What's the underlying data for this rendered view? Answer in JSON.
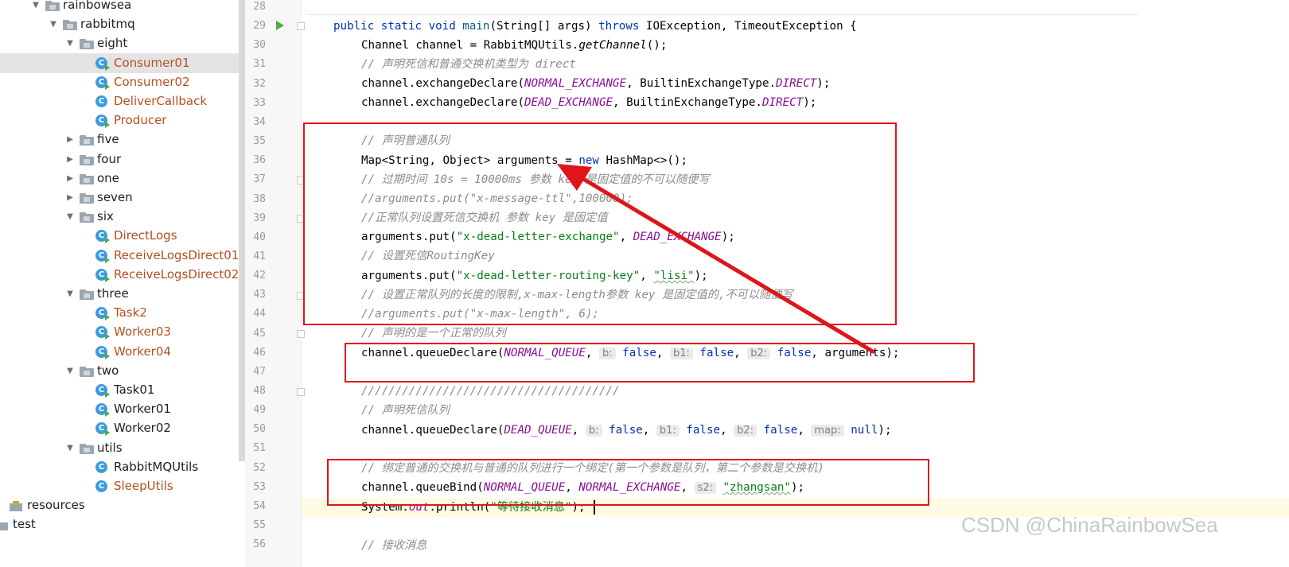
{
  "project_tree": {
    "nodes": [
      {
        "label": "rainbowsea",
        "kind": "package",
        "expanded": true
      },
      {
        "label": "rabbitmq",
        "kind": "package",
        "expanded": true
      },
      {
        "label": "eight",
        "kind": "package",
        "expanded": true
      },
      {
        "label": "Consumer01",
        "kind": "class-runnable",
        "modified": true,
        "selected": true
      },
      {
        "label": "Consumer02",
        "kind": "class-runnable",
        "modified": true
      },
      {
        "label": "DeliverCallback",
        "kind": "class",
        "modified": true
      },
      {
        "label": "Producer",
        "kind": "class-runnable",
        "modified": true
      },
      {
        "label": "five",
        "kind": "package",
        "expanded": false
      },
      {
        "label": "four",
        "kind": "package",
        "expanded": false
      },
      {
        "label": "one",
        "kind": "package",
        "expanded": false
      },
      {
        "label": "seven",
        "kind": "package",
        "expanded": false
      },
      {
        "label": "six",
        "kind": "package",
        "expanded": true
      },
      {
        "label": "DirectLogs",
        "kind": "class-runnable",
        "modified": true
      },
      {
        "label": "ReceiveLogsDirect01",
        "kind": "class-runnable",
        "modified": true
      },
      {
        "label": "ReceiveLogsDirect02",
        "kind": "class-runnable",
        "modified": true
      },
      {
        "label": "three",
        "kind": "package",
        "expanded": true
      },
      {
        "label": "Task2",
        "kind": "class-runnable",
        "modified": true
      },
      {
        "label": "Worker03",
        "kind": "class-runnable",
        "modified": true
      },
      {
        "label": "Worker04",
        "kind": "class-runnable",
        "modified": true
      },
      {
        "label": "two",
        "kind": "package",
        "expanded": true
      },
      {
        "label": "Task01",
        "kind": "class-runnable",
        "modified": false
      },
      {
        "label": "Worker01",
        "kind": "class-runnable",
        "modified": false
      },
      {
        "label": "Worker02",
        "kind": "class-runnable",
        "modified": false
      },
      {
        "label": "utils",
        "kind": "package",
        "expanded": true
      },
      {
        "label": "RabbitMQUtils",
        "kind": "class",
        "modified": false
      },
      {
        "label": "SleepUtils",
        "kind": "class",
        "modified": true
      },
      {
        "label": "resources",
        "kind": "resources"
      },
      {
        "label": "test",
        "kind": "test"
      }
    ],
    "class_icon_letter": "C"
  },
  "editor": {
    "line_numbers": [
      "28",
      "29",
      "30",
      "31",
      "32",
      "33",
      "34",
      "35",
      "36",
      "37",
      "38",
      "39",
      "40",
      "41",
      "42",
      "43",
      "44",
      "45",
      "46",
      "47",
      "48",
      "49",
      "50",
      "51",
      "52",
      "53",
      "54",
      "55",
      "56"
    ],
    "current_line": "54",
    "code": {
      "l29": {
        "a": "public static void ",
        "b": "main",
        "c": "(String[] args) ",
        "d": "throws",
        "e": " IOException, TimeoutException {"
      },
      "l30": {
        "a": "Channel channel = RabbitMQUtils.",
        "b": "getChannel",
        "c": "();"
      },
      "l31": "// 声明死信和普通交换机类型为 direct",
      "l32": {
        "a": "channel.exchangeDeclare(",
        "b": "NORMAL_EXCHANGE",
        "c": ", BuiltinExchangeType.",
        "d": "DIRECT",
        "e": ");"
      },
      "l33": {
        "a": "channel.exchangeDeclare(",
        "b": "DEAD_EXCHANGE",
        "c": ", BuiltinExchangeType.",
        "d": "DIRECT",
        "e": ");"
      },
      "l35": "// 声明普通队列",
      "l36": {
        "a": "Map<String, Object> arguments = ",
        "b": "new",
        "c": " HashMap<>();"
      },
      "l37": "// 过期时间 10s = 10000ms 参数 key 是固定值的不可以随便写",
      "l38": "//arguments.put(\"x-message-ttl\",100000);",
      "l39": "//正常队列设置死信交换机 参数 key 是固定值",
      "l40": {
        "a": "arguments.put(",
        "b": "\"x-dead-letter-exchange\"",
        "c": ", ",
        "d": "DEAD_EXCHANGE",
        "e": ");"
      },
      "l41": "// 设置死信RoutingKey",
      "l42": {
        "a": "arguments.put(",
        "b": "\"x-dead-letter-routing-key\"",
        "c": ", ",
        "d": "\"lisi\"",
        "e": ");"
      },
      "l43": "// 设置正常队列的长度的限制,x-max-length参数 key 是固定值的,不可以随便写",
      "l44": "//arguments.put(\"x-max-length\", 6);",
      "l45": "// 声明的是一个正常的队列",
      "l46": {
        "a": "channel.queueDeclare(",
        "b": "NORMAL_QUEUE",
        "c": ", ",
        "h1": "b:",
        "v1": "false",
        "s1": ", ",
        "h2": "b1:",
        "v2": "false",
        "s2": ", ",
        "h3": "b2:",
        "v3": "false",
        "e": ", arguments);"
      },
      "l48": "//////////////////////////////////////",
      "l49": "// 声明死信队列",
      "l50": {
        "a": "channel.queueDeclare(",
        "b": "DEAD_QUEUE",
        "c": ", ",
        "h1": "b:",
        "v1": "false",
        "s1": ", ",
        "h2": "b1:",
        "v2": "false",
        "s2": ", ",
        "h3": "b2:",
        "v3": "false",
        "s3": ", ",
        "h4": "map:",
        "v4": "null",
        "e": ");"
      },
      "l52": "// 绑定普通的交换机与普通的队列进行一个绑定(第一个参数是队列，第二个参数是交换机)",
      "l53": {
        "a": "channel.queueBind(",
        "b": "NORMAL_QUEUE",
        "c": ", ",
        "d": "NORMAL_EXCHANGE",
        "e": ", ",
        "h1": "s2:",
        "f": "\"zhangsan\"",
        "g": ");"
      },
      "l54": {
        "a": "System.",
        "b": "out",
        "c": ".println(",
        "d": "\"等待接收消息\"",
        "e": ");"
      },
      "l56": "// 接收消息"
    }
  },
  "annotations": {
    "box_color": "#e0151b",
    "arrow_color": "#e0151b"
  },
  "watermark": "CSDN @ChinaRainbowSea",
  "colors": {
    "keyword": "#0033b3",
    "comment": "#8c8c8c",
    "string": "#067d17",
    "constant": "#871094",
    "modified_file": "#b3501f",
    "current_line_bg": "#fffae3"
  }
}
